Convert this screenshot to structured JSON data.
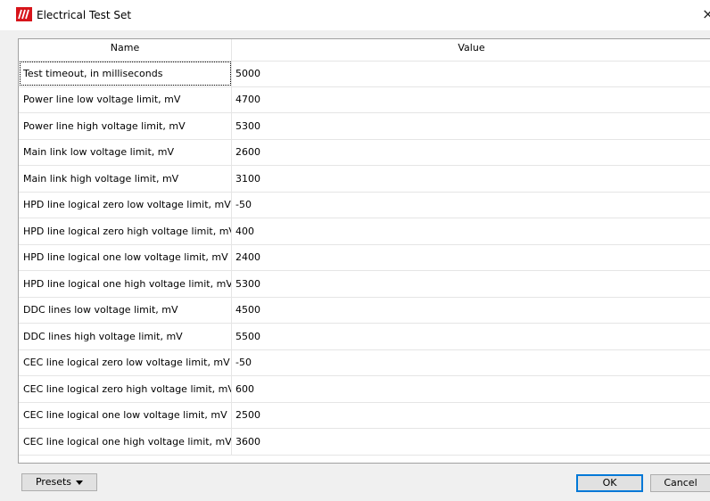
{
  "window": {
    "title": "Electrical Test Set",
    "icon": "red-stripes-logo-icon",
    "close_glyph": "×"
  },
  "table": {
    "columns": [
      "Name",
      "Value"
    ],
    "rows": [
      {
        "name": "Test timeout, in milliseconds",
        "value": "5000"
      },
      {
        "name": "Power line low voltage limit, mV",
        "value": "4700"
      },
      {
        "name": "Power line high voltage limit, mV",
        "value": "5300"
      },
      {
        "name": "Main link low voltage limit, mV",
        "value": "2600"
      },
      {
        "name": "Main link high voltage limit, mV",
        "value": "3100"
      },
      {
        "name": "HPD line logical zero low voltage limit, mV",
        "value": "-50"
      },
      {
        "name": "HPD line logical zero high voltage limit, mV",
        "value": "400"
      },
      {
        "name": "HPD line logical one low voltage limit, mV",
        "value": "2400"
      },
      {
        "name": "HPD line logical one high voltage limit, mV",
        "value": "5300"
      },
      {
        "name": "DDC lines low voltage limit, mV",
        "value": "4500"
      },
      {
        "name": "DDC lines high voltage limit, mV",
        "value": "5500"
      },
      {
        "name": "CEC line logical zero low voltage limit, mV",
        "value": "-50"
      },
      {
        "name": "CEC line logical zero high voltage limit, mV",
        "value": "600"
      },
      {
        "name": "CEC line logical one low voltage limit, mV",
        "value": "2500"
      },
      {
        "name": "CEC line logical one high voltage limit, mV",
        "value": "3600"
      }
    ]
  },
  "buttons": {
    "presets": "Presets",
    "ok": "OK",
    "cancel": "Cancel"
  },
  "colors": {
    "logo": "#d7141a",
    "ok_border": "#0078d7"
  }
}
